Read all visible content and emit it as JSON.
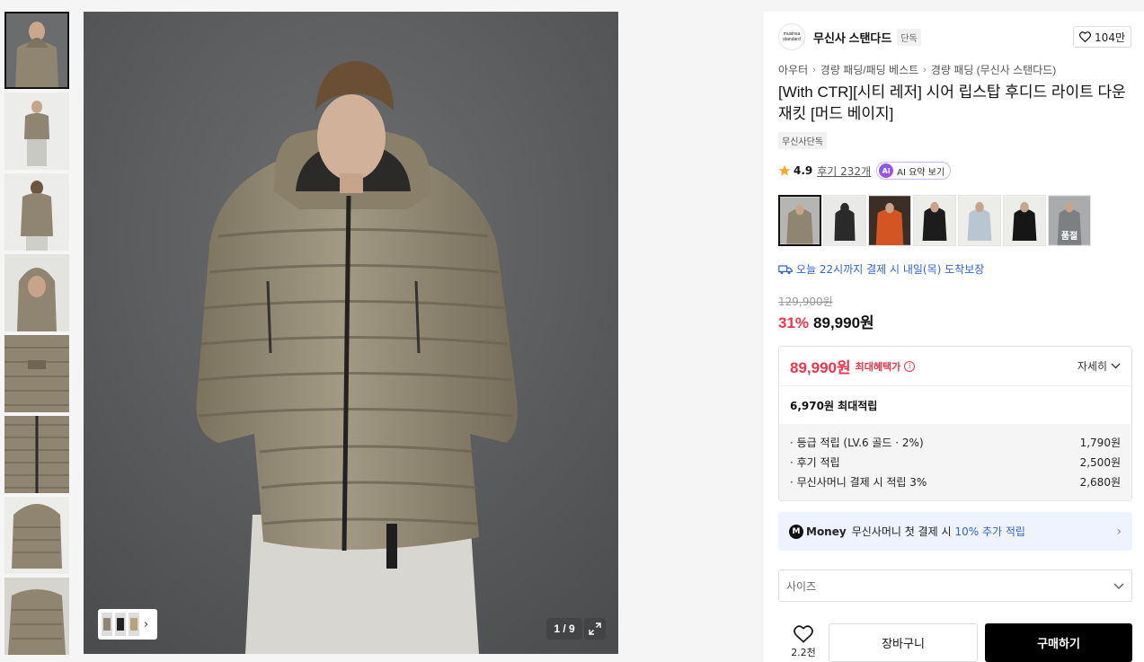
{
  "gallery": {
    "counter": "1 / 9"
  },
  "brand": {
    "logo_text": "musinsa standard",
    "name": "무신사 스탠다드",
    "badge": "단독",
    "like_count": "104만"
  },
  "breadcrumb": [
    "아우터",
    "경량 패딩/패딩 베스트",
    "경량 패딩 (무신사 스탠다드)"
  ],
  "product": {
    "title": "[With CTR][시티 레저] 시어 립스탑 후디드 라이트 다운 재킷 [머드 베이지]",
    "exclusive_tag": "무신사단독",
    "rating": "4.9",
    "reviews": "후기 232개",
    "ai_badge": "Ai",
    "ai_label": "AI 요약 보기",
    "sold_out_label": "품절"
  },
  "delivery": {
    "text": "오늘 22시까지 결제 시 내일(목) 도착보장"
  },
  "price": {
    "original": "129,900원",
    "discount": "31%",
    "current": "89,990원"
  },
  "benefit": {
    "max_price": "89,990원",
    "max_label": "최대혜택가",
    "info_icon": "i",
    "detail_label": "자세히",
    "max_points": "6,970원 최대적립",
    "items": [
      {
        "label": "· 등급 적립 (LV.6 골드 · 2%)",
        "value": "1,790원"
      },
      {
        "label": "· 후기 적립",
        "value": "2,500원"
      },
      {
        "label": "· 무신사머니 결제 시 적립 3%",
        "value": "2,680원"
      }
    ]
  },
  "money_banner": {
    "logo": "M",
    "brand": "Money",
    "text_before": "무신사머니 첫 결제 시",
    "highlight": "10% 추가 적립"
  },
  "size_select": {
    "placeholder": "사이즈"
  },
  "actions": {
    "wish_count": "2.2천",
    "cart_label": "장바구니",
    "buy_label": "구매하기"
  },
  "colors": {
    "jacket_beige": "#8f8570",
    "background_gray": "#5b5d5f",
    "accent_red": "#f2334a",
    "accent_blue": "#2e63d8"
  }
}
